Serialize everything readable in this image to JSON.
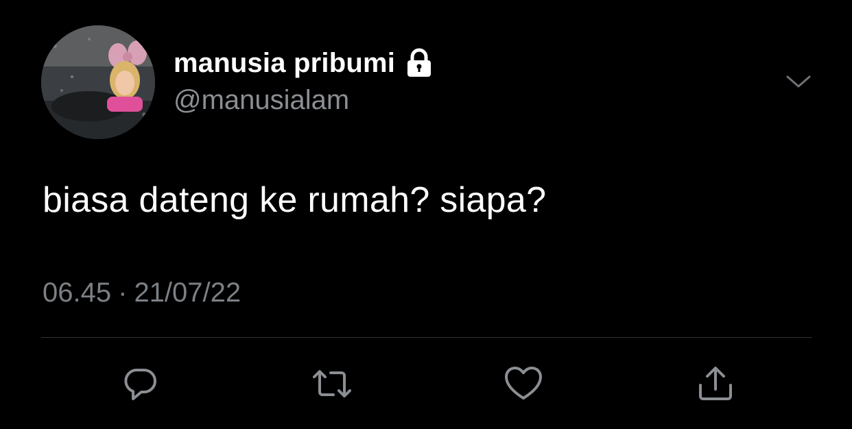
{
  "tweet": {
    "display_name": "manusia pribumi",
    "handle": "@manusialam",
    "text": "biasa dateng ke rumah? siapa?",
    "time": "06.45",
    "separator": "·",
    "date": "21/07/22",
    "protected_icon": "lock-icon"
  },
  "header": {
    "more_icon": "chevron-down-icon"
  },
  "actions": [
    {
      "name": "reply",
      "icon": "reply-icon"
    },
    {
      "name": "retweet",
      "icon": "retweet-icon"
    },
    {
      "name": "like",
      "icon": "heart-icon"
    },
    {
      "name": "share",
      "icon": "share-icon"
    }
  ],
  "colors": {
    "background": "#000000",
    "text_primary": "#ffffff",
    "text_secondary": "#8b8f94",
    "icon": "#8b8f94",
    "divider": "#2f3336"
  }
}
